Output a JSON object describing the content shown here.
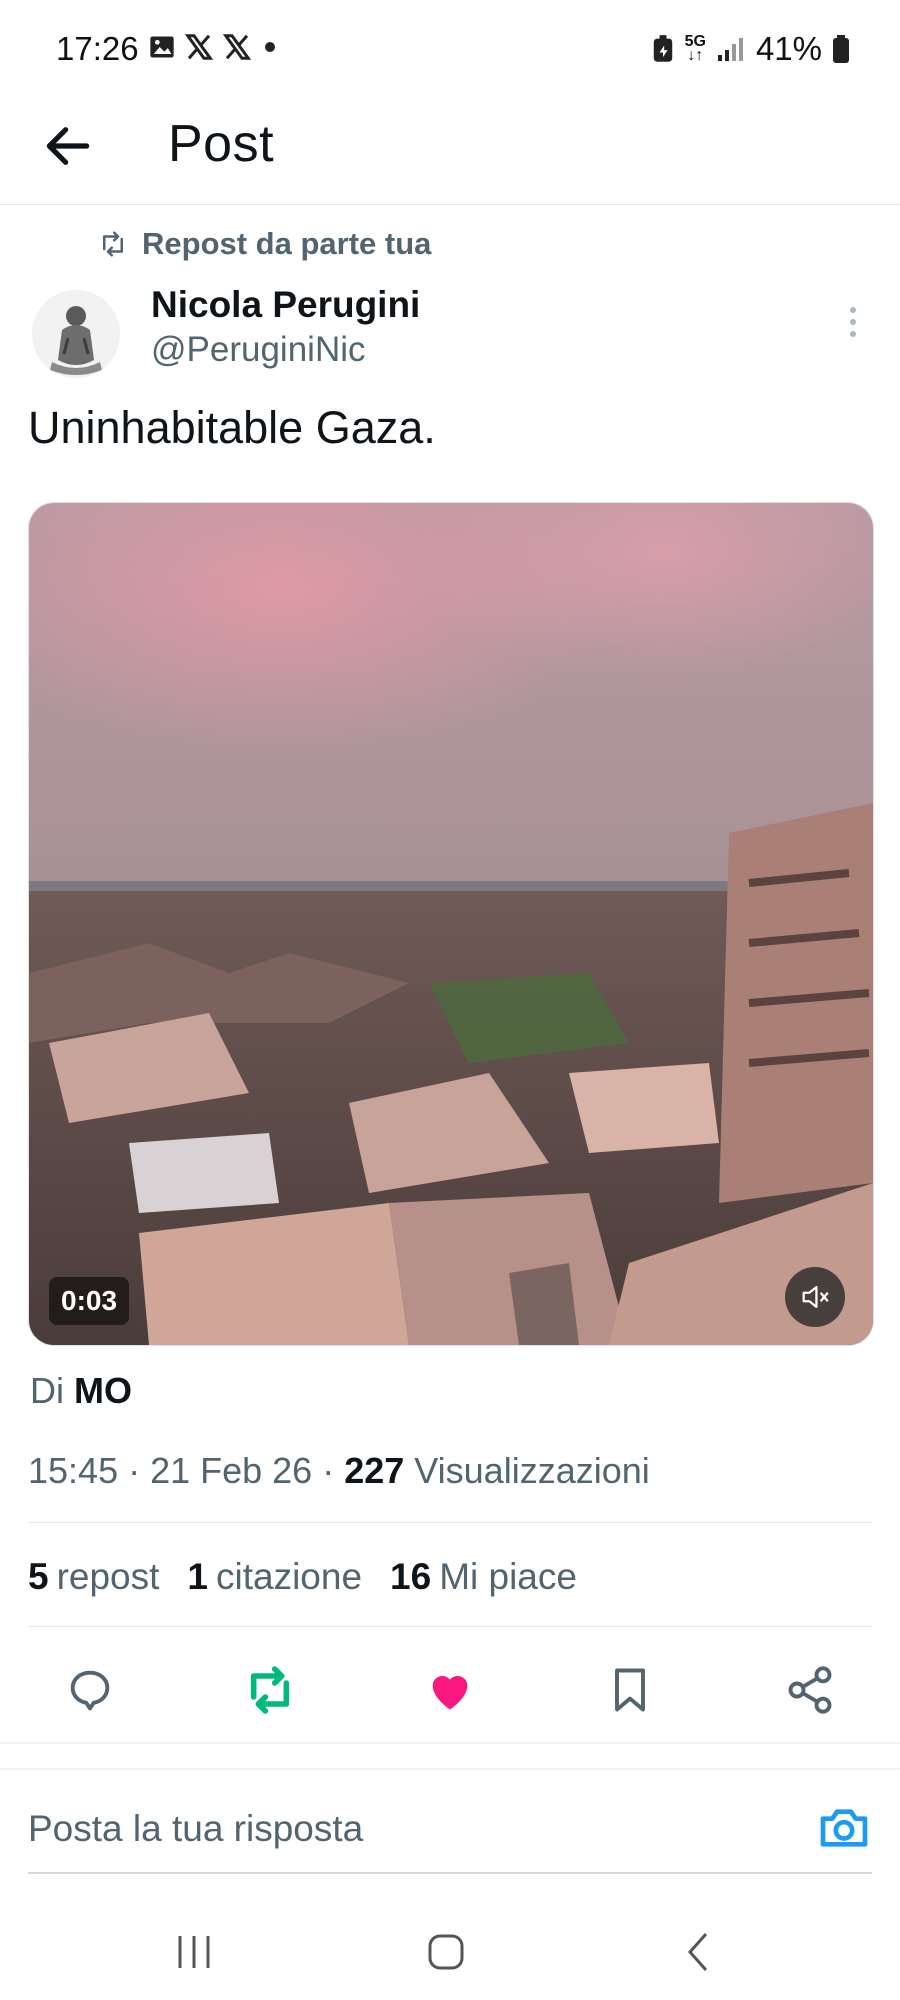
{
  "status_bar": {
    "time": "17:26",
    "network": "5G",
    "battery": "41%",
    "left_icons": [
      "image-icon",
      "x-logo-icon",
      "x-logo-icon",
      "dot-icon"
    ],
    "right_icons": [
      "battery-saver-icon",
      "5g-icon",
      "signal-icon",
      "battery-icon"
    ]
  },
  "header": {
    "title": "Post",
    "back_icon": "arrow-left-icon"
  },
  "post": {
    "repost_label": "Repost da parte tua",
    "author_name": "Nicola Perugini",
    "author_handle": "@PeruginiNic",
    "text": "Uninhabitable Gaza.",
    "video_duration": "0:03",
    "source_prefix": "Di",
    "source_name": "MO",
    "timestamp": "15:45 · 21 Feb 26 · ",
    "views_count": "227",
    "views_label": "Visualizzazioni",
    "stats": {
      "reposts_count": "5",
      "reposts_label": "repost",
      "quotes_count": "1",
      "quotes_label": "citazione",
      "likes_count": "16",
      "likes_label": "Mi piace"
    }
  },
  "actions": [
    "reply-icon",
    "repost-icon",
    "like-icon",
    "bookmark-icon",
    "share-icon"
  ],
  "colors": {
    "repost_active": "#00ba7c",
    "like_active": "#f91880",
    "camera_accent": "#1d9bf0",
    "secondary_text": "#536471"
  },
  "reply": {
    "placeholder": "Posta la tua risposta"
  },
  "navbar": [
    "recent-apps-icon",
    "home-icon",
    "back-icon"
  ]
}
